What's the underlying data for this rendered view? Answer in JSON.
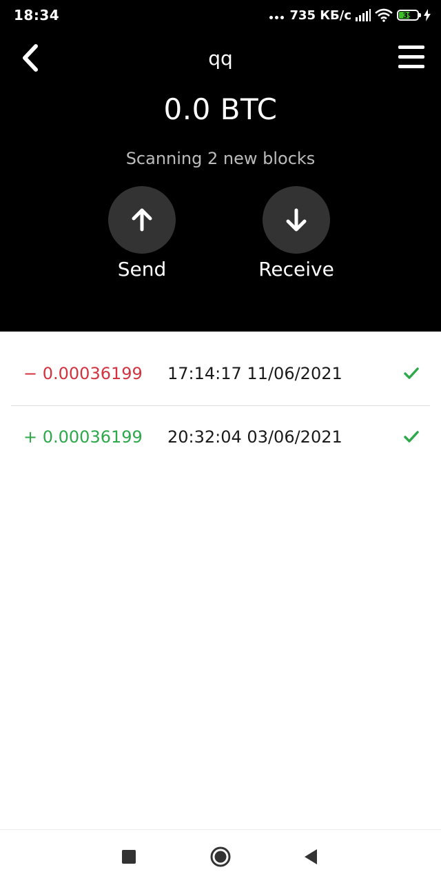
{
  "status_bar": {
    "time": "18:34",
    "network_speed": "735 КБ/с",
    "battery_level": "39",
    "icons": [
      "more-dots-icon",
      "signal-icon",
      "wifi-icon",
      "battery-icon",
      "charging-bolt-icon"
    ]
  },
  "nav": {
    "title": "qq",
    "back_icon": "chevron-left-icon",
    "menu_icon": "hamburger-menu-icon"
  },
  "wallet": {
    "balance": "0.0 BTC",
    "sync_status": "Scanning 2 new blocks"
  },
  "actions": {
    "send_label": "Send",
    "receive_label": "Receive"
  },
  "transactions": [
    {
      "amount": "− 0.00036199",
      "datetime": "17:14:17 11/06/2021",
      "direction": "outgoing",
      "color": "#d2333f",
      "confirmed": true
    },
    {
      "amount": "+ 0.00036199",
      "datetime": "20:32:04 03/06/2021",
      "direction": "incoming",
      "color": "#2da84a",
      "confirmed": true
    }
  ],
  "colors": {
    "header_bg": "#000000",
    "button_circle": "#333333",
    "outgoing": "#d2333f",
    "incoming": "#2da84a",
    "confirm_check": "#2da84a"
  },
  "system_nav": {
    "icons": [
      "recent-apps-square-icon",
      "home-circle-icon",
      "back-triangle-icon"
    ]
  }
}
